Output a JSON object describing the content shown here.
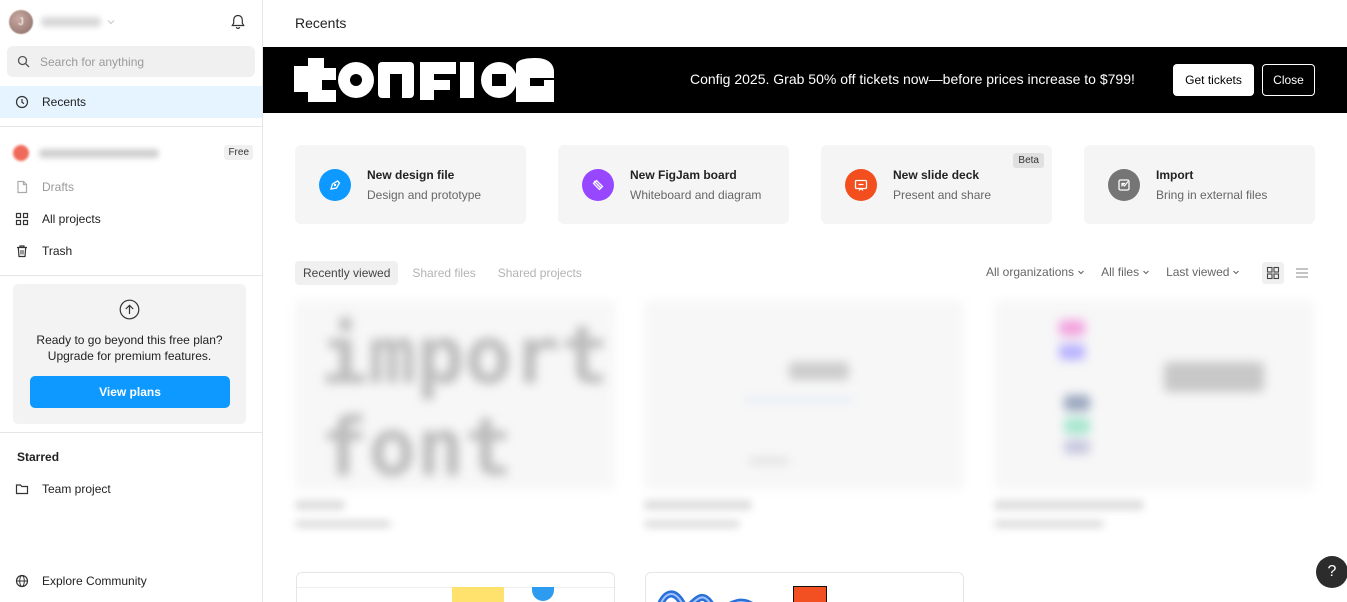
{
  "sidebar": {
    "account": {
      "avatar_letter": "J"
    },
    "search": {
      "placeholder": "Search for anything"
    },
    "nav": {
      "recents": "Recents",
      "drafts": "Drafts",
      "all_projects": "All projects",
      "trash": "Trash"
    },
    "team": {
      "badge": "Free"
    },
    "upgrade": {
      "line1": "Ready to go beyond this free plan?",
      "line2": "Upgrade for premium features.",
      "button": "View plans"
    },
    "starred": {
      "heading": "Starred",
      "items": [
        {
          "label": "Team project"
        }
      ]
    },
    "explore": "Explore Community"
  },
  "main": {
    "title": "Recents",
    "banner": {
      "logo_text": "CONFIG",
      "message": "Config 2025. Grab 50% off tickets now—before prices increase to $799!",
      "tickets_button": "Get tickets",
      "close_button": "Close"
    },
    "create_cards": [
      {
        "title": "New design file",
        "subtitle": "Design and prototype",
        "icon": "pen-tool-icon",
        "color": "#0d99ff"
      },
      {
        "title": "New FigJam board",
        "subtitle": "Whiteboard and diagram",
        "icon": "marker-icon",
        "color": "#9747ff"
      },
      {
        "title": "New slide deck",
        "subtitle": "Present and share",
        "icon": "slides-icon",
        "color": "#f24e1e",
        "badge": "Beta"
      },
      {
        "title": "Import",
        "subtitle": "Bring in external files",
        "icon": "import-icon",
        "color": "#757575"
      }
    ],
    "tabs": [
      "Recently viewed",
      "Shared files",
      "Shared projects"
    ],
    "filters": [
      "All organizations",
      "All files",
      "Last viewed"
    ],
    "view_modes": [
      "grid-view-icon",
      "list-view-icon"
    ],
    "help": "?"
  },
  "colors": {
    "accent": "#0d99ff",
    "active_nav_bg": "#e5f4ff",
    "banner_bg": "#000000"
  }
}
